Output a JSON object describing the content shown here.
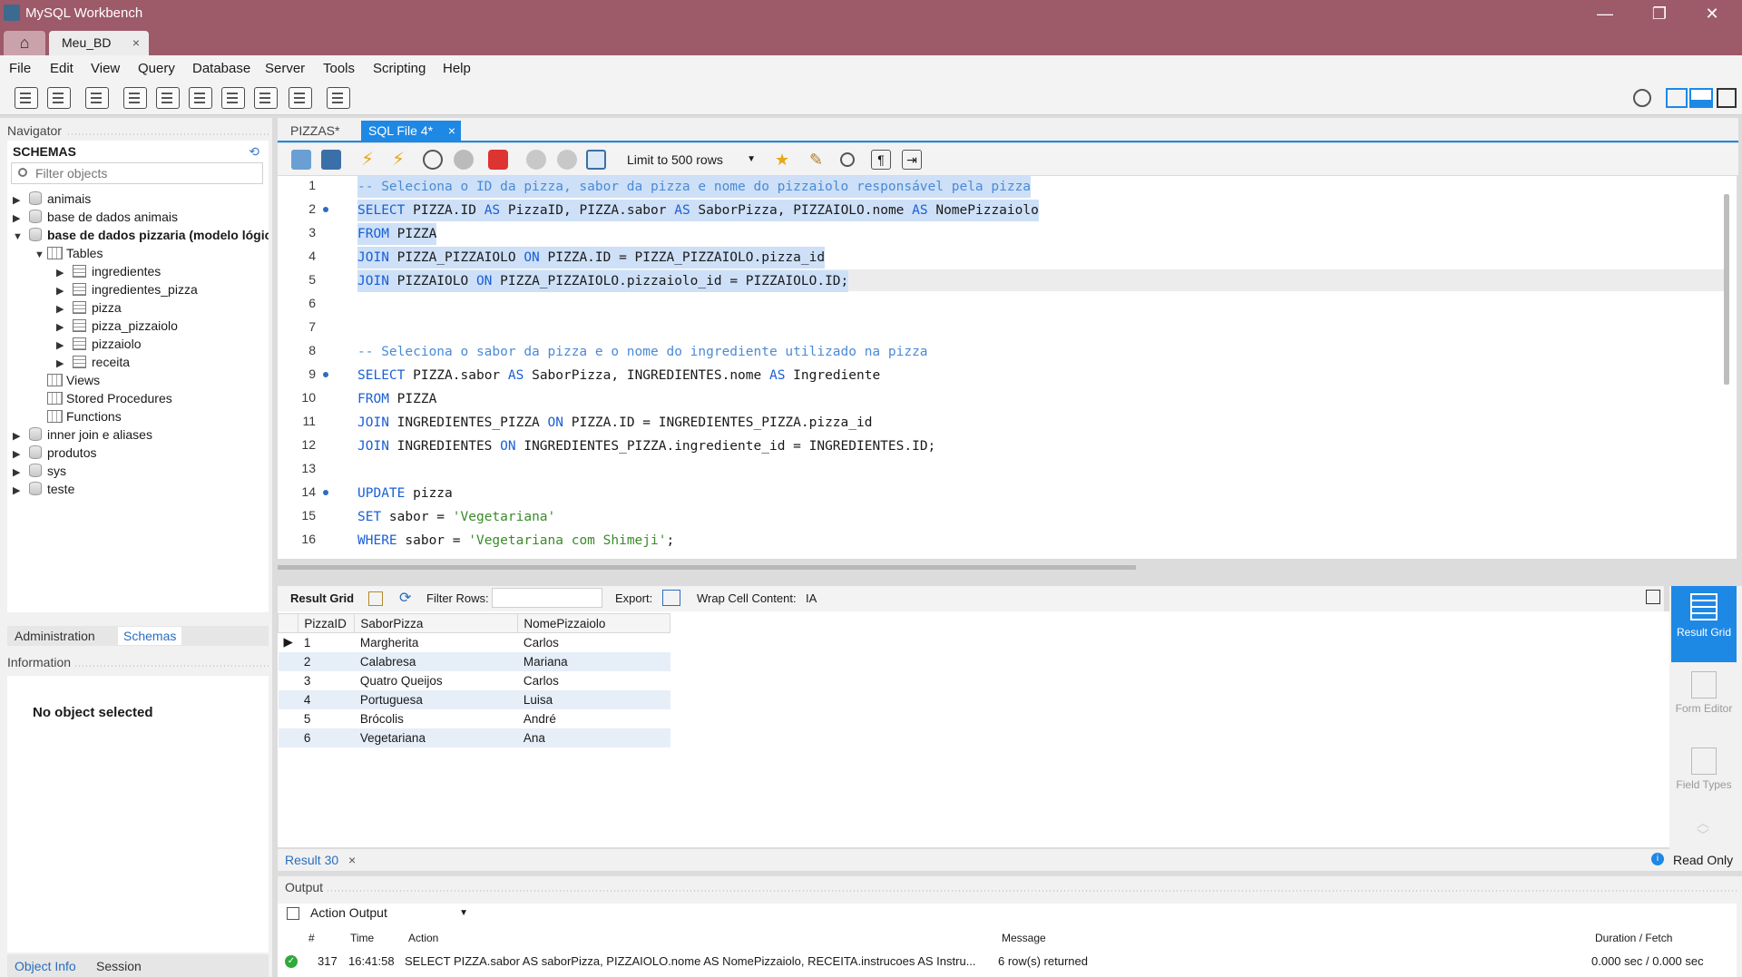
{
  "window": {
    "title": "MySQL Workbench",
    "tab": "Meu_BD",
    "tab_close": "×",
    "min": "—",
    "max": "❐",
    "close": "✕"
  },
  "menu": [
    "File",
    "Edit",
    "View",
    "Query",
    "Database",
    "Server",
    "Tools",
    "Scripting",
    "Help"
  ],
  "navigator": {
    "title": "Navigator",
    "schemas_title": "SCHEMAS",
    "filter_placeholder": "Filter objects",
    "tree": {
      "animais": "animais",
      "base_animais": "base de dados animais",
      "base_pizzaria": "base de dados pizzaria (modelo lógico)",
      "tables": "Tables",
      "t1": "ingredientes",
      "t2": "ingredientes_pizza",
      "t3": "pizza",
      "t4": "pizza_pizzaiolo",
      "t5": "pizzaiolo",
      "t6": "receita",
      "views": "Views",
      "stored": "Stored Procedures",
      "functions": "Functions",
      "inner": "inner join e aliases",
      "produtos": "produtos",
      "sys": "sys",
      "teste": "teste"
    },
    "tab_admin": "Administration",
    "tab_schemas": "Schemas",
    "info_title": "Information",
    "no_object": "No object selected",
    "tab_object_info": "Object Info",
    "tab_session": "Session"
  },
  "editor": {
    "tab1": "PIZZAS*",
    "tab2": "SQL File 4*",
    "tab2_close": "×",
    "limit": "Limit to 500 rows"
  },
  "code": {
    "l1": "-- Seleciona o ID da pizza, sabor da pizza e nome do pizzaiolo responsável pela pizza",
    "l8": "-- Seleciona o sabor da pizza e o nome do ingrediente utilizado na pizza"
  },
  "result": {
    "grid_label": "Result Grid",
    "filter_rows": "Filter Rows:",
    "export": "Export:",
    "wrap": "Wrap Cell Content:",
    "columns": [
      "PizzaID",
      "SaborPizza",
      "NomePizzaiolo"
    ],
    "rows": [
      [
        "1",
        "Margherita",
        "Carlos"
      ],
      [
        "2",
        "Calabresa",
        "Mariana"
      ],
      [
        "3",
        "Quatro Queijos",
        "Carlos"
      ],
      [
        "4",
        "Portuguesa",
        "Luisa"
      ],
      [
        "5",
        "Brócolis",
        "André"
      ],
      [
        "6",
        "Vegetariana",
        "Ana"
      ]
    ],
    "rail": {
      "result_grid": "Result Grid",
      "form_editor": "Form Editor",
      "field_types": "Field Types"
    },
    "tab": "Result 30",
    "tab_close": "×",
    "read_only": "Read Only"
  },
  "output": {
    "title": "Output",
    "select": "Action Output",
    "headers": {
      "num": "#",
      "time": "Time",
      "action": "Action",
      "message": "Message",
      "duration": "Duration / Fetch"
    },
    "row": {
      "num": "317",
      "time": "16:41:58",
      "action": "SELECT PIZZA.sabor AS saborPizza, PIZZAIOLO.nome AS NomePizzaiolo, RECEITA.instrucoes AS Instru...",
      "message": "6 row(s) returned",
      "duration": "0.000 sec / 0.000 sec"
    }
  },
  "colors": {
    "titlebar": "#9d5a68",
    "accent": "#1e88e5",
    "selection": "#cde0f7",
    "keyword": "#1a5fd6"
  }
}
